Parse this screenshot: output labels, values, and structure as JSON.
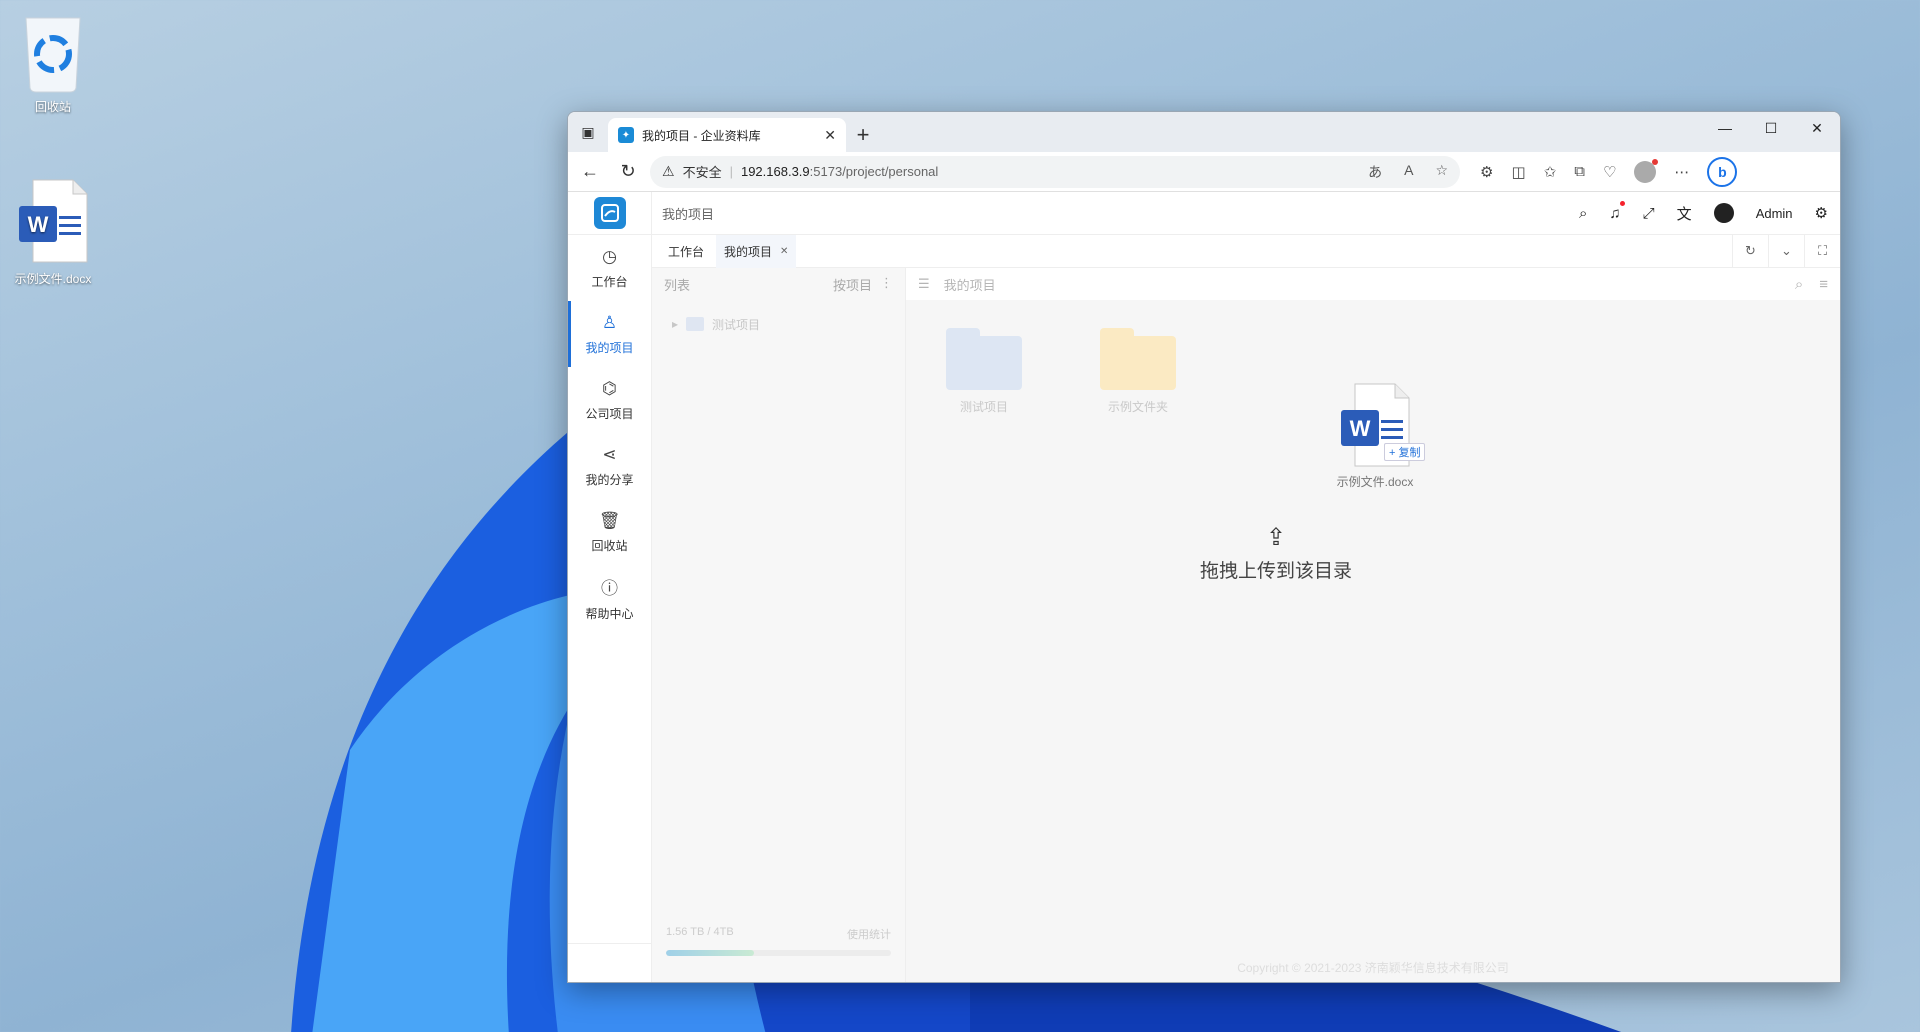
{
  "desktop": {
    "recycle_bin_label": "回收站",
    "docx_label": "示例文件.docx"
  },
  "browser": {
    "tab_title": "我的项目 - 企业资料库",
    "security_label": "不安全",
    "url_host": "192.168.3.9",
    "url_path": ":5173/project/personal"
  },
  "app": {
    "breadcrumb": "我的项目",
    "user_name": "Admin",
    "sidebar": [
      {
        "label": "工作台",
        "icon": "dashboard-icon"
      },
      {
        "label": "我的项目",
        "icon": "user-icon",
        "active": true
      },
      {
        "label": "公司项目",
        "icon": "org-icon"
      },
      {
        "label": "我的分享",
        "icon": "share-icon"
      },
      {
        "label": "回收站",
        "icon": "trash-icon"
      },
      {
        "label": "帮助中心",
        "icon": "help-icon"
      }
    ],
    "page_tabs": [
      {
        "label": "工作台"
      },
      {
        "label": "我的项目",
        "active": true
      }
    ],
    "left_panel": {
      "title": "列表",
      "sort_label": "按项目",
      "tree_item": "测试项目",
      "storage_text": "1.56 TB / 4TB",
      "usage_label": "使用统计",
      "usage_fraction": 0.39
    },
    "right_panel": {
      "title": "我的项目",
      "files": [
        {
          "name": "测试项目",
          "kind": "project-folder"
        },
        {
          "name": "示例文件夹",
          "kind": "folder"
        }
      ],
      "dragging_file": "示例文件.docx",
      "copy_tag": "+ 复制",
      "drop_hint": "拖拽上传到该目录"
    },
    "copyright": "Copyright © 2021-2023 济南颖华信息技术有限公司"
  }
}
